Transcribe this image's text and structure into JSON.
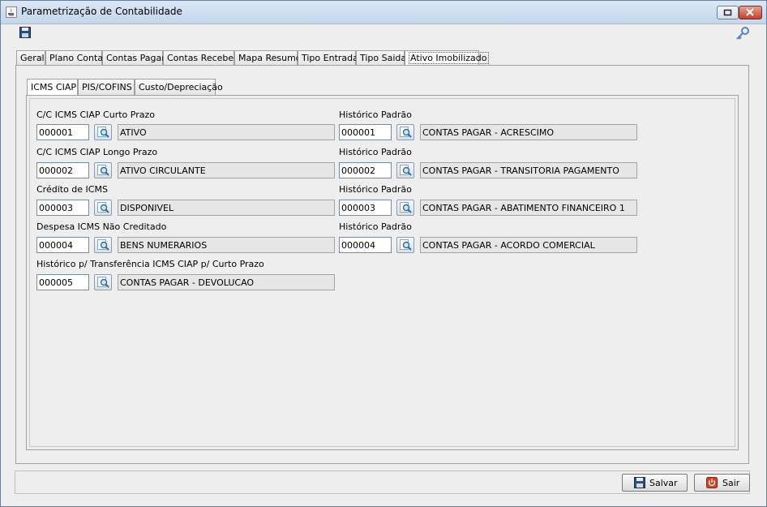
{
  "window": {
    "title": "Parametrização de Contabilidade"
  },
  "tabs": [
    {
      "label": "Geral"
    },
    {
      "label": "Plano Conta"
    },
    {
      "label": "Contas Pagar"
    },
    {
      "label": "Contas Receber"
    },
    {
      "label": "Mapa Resumo"
    },
    {
      "label": "Tipo Entrada"
    },
    {
      "label": "Tipo Saida"
    },
    {
      "label": "Ativo Imobilizado"
    }
  ],
  "active_tab": "Ativo Imobilizado",
  "subtabs": [
    {
      "label": "ICMS CIAP"
    },
    {
      "label": "PIS/COFINS"
    },
    {
      "label": "Custo/Depreciação"
    }
  ],
  "active_subtab": "ICMS CIAP",
  "left_fields": [
    {
      "label": "C/C ICMS CIAP Curto Prazo",
      "code": "000001",
      "desc": "ATIVO"
    },
    {
      "label": "C/C ICMS CIAP Longo Prazo",
      "code": "000002",
      "desc": "ATIVO CIRCULANTE"
    },
    {
      "label": "Crédito de ICMS",
      "code": "000003",
      "desc": "DISPONIVEL"
    },
    {
      "label": "Despesa ICMS Não Creditado",
      "code": "000004",
      "desc": "BENS NUMERARIOS"
    },
    {
      "label": "Histórico p/ Transferência ICMS CIAP p/ Curto Prazo",
      "code": "000005",
      "desc": "CONTAS PAGAR - DEVOLUCAO"
    }
  ],
  "right_fields": [
    {
      "label": "Histórico Padrão",
      "code": "000001",
      "desc": "CONTAS PAGAR - ACRESCIMO"
    },
    {
      "label": "Histórico Padrão",
      "code": "000002",
      "desc": "CONTAS PAGAR - TRANSITORIA PAGAMENTO"
    },
    {
      "label": "Histórico Padrão",
      "code": "000003",
      "desc": "CONTAS PAGAR - ABATIMENTO FINANCEIRO 1"
    },
    {
      "label": "Histórico Padrão",
      "code": "000004",
      "desc": "CONTAS PAGAR - ACORDO COMERCIAL"
    }
  ],
  "buttons": {
    "save": "Salvar",
    "exit": "Sair"
  },
  "icons": {
    "save": "floppy-disk-icon",
    "key": "key-icon",
    "lookup": "magnifier-icon",
    "exit": "power-icon"
  },
  "colors": {
    "titlebar": "#c4d6ec",
    "panel": "#eeeeee",
    "exit_icon": "#d9401f"
  }
}
